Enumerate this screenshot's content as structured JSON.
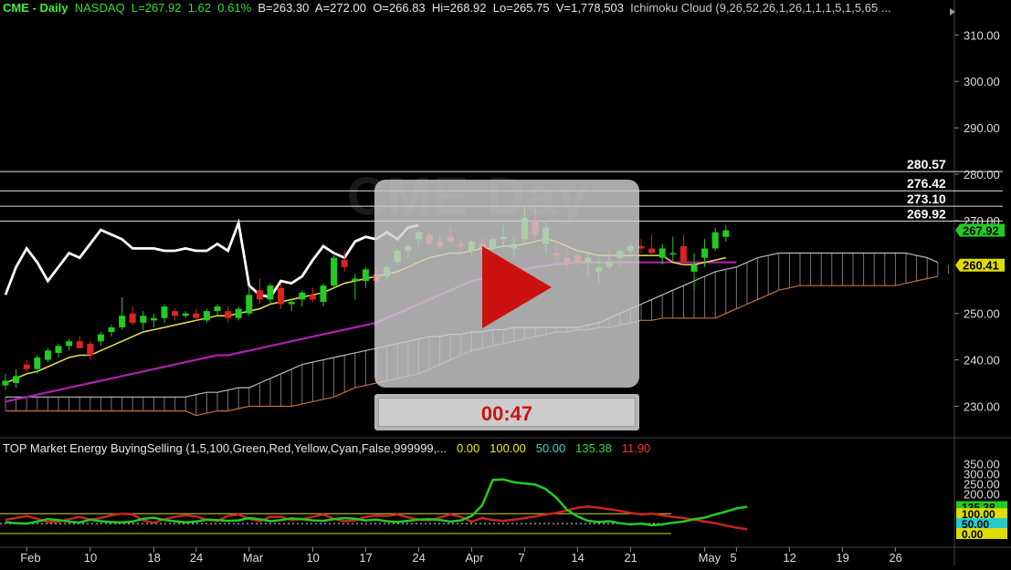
{
  "header": {
    "symbol": "CME - Daily",
    "exchange": "NASDAQ",
    "last": "L=267.92",
    "change": "1.62",
    "change_pct": "0.61%",
    "bid": "B=263.30",
    "ask": "A=272.00",
    "open": "O=266.83",
    "high": "Hi=268.92",
    "low": "Lo=265.75",
    "volume": "V=1,778,503",
    "study": "Ichimoku Cloud (9,26,52,26,1,26,1,1,1,5,1,5,65 ..."
  },
  "price_axis": [
    "310.00",
    "300.00",
    "290.00",
    "280.00",
    "270.00",
    "250.00",
    "240.00",
    "230.00"
  ],
  "levels": [
    {
      "label": "280.57",
      "value": 280.57
    },
    {
      "label": "276.42",
      "value": 276.42
    },
    {
      "label": "273.10",
      "value": 273.1
    },
    {
      "label": "269.92",
      "value": 269.92
    }
  ],
  "price_badges": [
    {
      "label": "267.92",
      "value": 267.92,
      "color": "#22cc22"
    },
    {
      "label": "260.41",
      "value": 260.41,
      "color": "#dddd00"
    }
  ],
  "indicator": {
    "title": "TOP Market Energy BuyingSelling (1,5,100,Green,Red,Yellow,Cyan,False,999999,...",
    "v1": "0.00",
    "v2": "100.00",
    "v3": "50.00",
    "v4": "135.38",
    "v5": "11.90",
    "axis": [
      "350.00",
      "300.00",
      "250.00",
      "200.00"
    ],
    "badges": [
      {
        "label": "135.38",
        "value": 135.38,
        "color": "#22cc22"
      },
      {
        "label": "100.00",
        "value": 100,
        "color": "#dddd00"
      },
      {
        "label": "50.00",
        "value": 50,
        "color": "#22cccc"
      },
      {
        "label": "0.00",
        "value": 0,
        "color": "#dddd00"
      }
    ]
  },
  "time_axis": [
    {
      "label": "Feb",
      "i": 2
    },
    {
      "label": "10",
      "i": 8
    },
    {
      "label": "18",
      "i": 14
    },
    {
      "label": "24",
      "i": 18
    },
    {
      "label": "Mar",
      "i": 23
    },
    {
      "label": "10",
      "i": 29
    },
    {
      "label": "17",
      "i": 34
    },
    {
      "label": "24",
      "i": 39
    },
    {
      "label": "Apr",
      "i": 44
    },
    {
      "label": "7",
      "i": 49
    },
    {
      "label": "14",
      "i": 54
    },
    {
      "label": "21",
      "i": 59
    },
    {
      "label": "May",
      "i": 66
    },
    {
      "label": "5",
      "i": 69
    },
    {
      "label": "12",
      "i": 74
    },
    {
      "label": "19",
      "i": 79
    },
    {
      "label": "26",
      "i": 84
    }
  ],
  "video": {
    "watermark": "CME Day",
    "timer": "00:47"
  },
  "colors": {
    "up": "#22cc22",
    "down": "#dd2222",
    "tenkan": "#e6e64a",
    "kijun": "#b020b0",
    "cloud": "#bbbbbb",
    "cloud_bear": "#c0703a",
    "chikou": "#ffffff",
    "buy": "#22cc22",
    "sell": "#cc2222"
  },
  "chart_data": {
    "type": "candlestick",
    "ylim": [
      224,
      314
    ],
    "candles": [
      [
        234.5,
        237,
        233.5,
        235.5
      ],
      [
        235,
        238,
        234,
        236.5
      ],
      [
        239,
        240,
        237.5,
        238
      ],
      [
        238,
        241,
        237,
        240.5
      ],
      [
        240,
        242.5,
        239.5,
        242
      ],
      [
        241.5,
        243.5,
        240.5,
        243
      ],
      [
        243,
        244.5,
        242,
        244
      ],
      [
        244,
        245,
        242.5,
        242.5
      ],
      [
        243.5,
        244,
        240,
        241
      ],
      [
        244,
        246,
        243,
        245.5
      ],
      [
        246,
        247.5,
        245,
        247
      ],
      [
        247,
        253.5,
        246.5,
        249.5
      ],
      [
        250,
        251.5,
        247.5,
        248
      ],
      [
        248,
        250.5,
        246.5,
        249.5
      ],
      [
        248.5,
        250,
        247,
        249
      ],
      [
        249,
        252,
        248,
        251.5
      ],
      [
        250.5,
        251,
        248.5,
        249.5
      ],
      [
        249.5,
        250.5,
        249,
        250
      ],
      [
        250,
        251,
        248.5,
        249
      ],
      [
        248.5,
        251,
        248,
        250.5
      ],
      [
        250.5,
        252,
        249.5,
        251.5
      ],
      [
        250.5,
        251.5,
        248,
        249
      ],
      [
        249,
        251.5,
        248.5,
        251
      ],
      [
        250,
        256,
        249.5,
        254
      ],
      [
        255,
        257.5,
        252,
        253
      ],
      [
        253,
        256.5,
        252,
        256
      ],
      [
        255.5,
        256.5,
        251,
        252
      ],
      [
        252,
        253,
        250.5,
        252.5
      ],
      [
        253,
        255,
        251.5,
        254.5
      ],
      [
        254,
        255.5,
        252.5,
        253
      ],
      [
        252.5,
        256.5,
        251.5,
        256
      ],
      [
        256,
        262.5,
        255.5,
        262
      ],
      [
        261.5,
        263.5,
        259,
        260
      ],
      [
        257,
        258.5,
        253,
        257.5
      ],
      [
        257,
        260,
        255.5,
        259.5
      ],
      [
        258.5,
        260,
        256.5,
        257
      ],
      [
        258,
        260.5,
        257.5,
        260
      ],
      [
        261,
        264,
        260.5,
        263.5
      ],
      [
        263.5,
        265,
        262,
        264.5
      ],
      [
        266,
        268,
        264.5,
        267.5
      ],
      [
        267,
        268,
        264.5,
        265
      ],
      [
        265.5,
        267,
        264,
        264.5
      ],
      [
        266.5,
        268.5,
        265,
        265.5
      ],
      [
        265,
        266,
        263.5,
        264.5
      ],
      [
        263.5,
        266,
        262.5,
        265.5
      ],
      [
        265,
        266.5,
        263,
        264
      ],
      [
        264,
        266.5,
        263.5,
        266
      ],
      [
        266,
        269,
        264.5,
        266.5
      ],
      [
        264,
        266.5,
        262,
        265
      ],
      [
        266,
        273,
        265,
        270.5
      ],
      [
        270,
        272.5,
        266,
        267
      ],
      [
        265,
        270,
        263,
        268.5
      ],
      [
        263,
        266,
        261,
        262.5
      ],
      [
        262,
        264,
        259.5,
        260.5
      ],
      [
        262.5,
        264,
        260,
        261
      ],
      [
        261,
        263,
        258,
        262
      ],
      [
        259,
        262,
        256.5,
        260
      ],
      [
        260,
        263.5,
        259.5,
        261
      ],
      [
        262,
        264,
        260,
        263.5
      ],
      [
        263.5,
        265,
        262.5,
        264.5
      ],
      [
        264.5,
        266,
        263,
        264
      ],
      [
        264,
        267,
        262.5,
        263
      ],
      [
        262,
        265,
        260.5,
        264
      ],
      [
        263,
        266.5,
        261,
        263
      ],
      [
        264.5,
        267,
        260.5,
        261
      ],
      [
        259,
        263,
        255,
        260.5
      ],
      [
        262,
        266,
        260,
        264
      ],
      [
        264,
        268.5,
        263.5,
        267.5
      ],
      [
        266.5,
        269,
        265.5,
        267.9
      ]
    ],
    "tenkan": [
      235,
      236,
      237,
      237.5,
      238.5,
      239.5,
      240.5,
      241,
      241,
      242,
      243,
      244,
      245,
      246,
      246.5,
      247,
      247.5,
      248,
      248.5,
      249,
      249.5,
      249.5,
      250,
      250.5,
      251,
      252,
      252.5,
      253,
      253.5,
      254,
      254.5,
      255.5,
      256.5,
      257,
      257.5,
      258,
      258.5,
      259,
      260,
      261,
      262,
      262.5,
      263,
      263,
      263.5,
      264,
      264,
      264.5,
      264.5,
      265,
      265.5,
      266,
      265.5,
      264.5,
      263.5,
      263,
      262.5,
      262.5,
      262.5,
      262.5,
      262.5,
      262.5,
      262.5,
      261,
      260.5,
      260.5,
      261,
      261.5,
      262
    ],
    "kijun": [
      231,
      231.5,
      232,
      232.5,
      233,
      233.5,
      234,
      234.5,
      235,
      235.5,
      236,
      236.5,
      237,
      237.5,
      238,
      238.5,
      239,
      239.5,
      240,
      240.5,
      241,
      241,
      241.5,
      242,
      242.5,
      243,
      243.5,
      244,
      244.5,
      245,
      245.5,
      246,
      246.5,
      247,
      247.5,
      248,
      249,
      250,
      251,
      252,
      253,
      254,
      255,
      256,
      257,
      257.5,
      258,
      258.5,
      259,
      259.5,
      260,
      260.3,
      260.6,
      260.8,
      261,
      261,
      261,
      261,
      261,
      261,
      261,
      261,
      261,
      261,
      261,
      261,
      261,
      261,
      261,
      261
    ],
    "chikou": [
      254,
      260,
      264,
      261,
      257,
      260,
      263,
      262,
      265,
      268,
      267,
      266,
      264,
      264,
      264,
      263.5,
      263.5,
      264,
      263.5,
      263.5,
      265,
      263.5,
      269.5,
      256,
      254,
      253.5,
      257,
      256.5,
      258,
      261.5,
      264.5,
      263,
      262,
      265.5,
      266.5,
      266,
      267.5,
      266,
      268.5,
      269
    ],
    "cloud_x0": 0,
    "span_a": [
      232,
      232,
      232,
      232,
      232,
      232,
      232,
      232,
      232,
      232,
      232,
      232,
      232,
      232,
      232,
      232,
      232,
      232,
      232.5,
      233,
      233,
      233.5,
      234,
      234,
      235,
      236,
      237,
      238,
      239,
      239.5,
      240,
      240.5,
      241,
      241.5,
      242,
      242.5,
      243,
      243.5,
      244,
      244.5,
      245,
      245,
      245.5,
      245.5,
      246,
      246,
      246.5,
      246.5,
      247,
      247,
      247,
      247,
      247,
      247,
      247,
      247.5,
      248,
      249,
      250,
      251,
      252,
      253,
      254,
      255,
      256,
      257,
      258,
      259,
      259.5,
      260,
      261,
      262,
      262.5,
      263,
      263,
      263,
      263,
      263,
      263,
      263,
      263,
      263,
      263,
      263,
      263,
      263,
      262.5,
      262,
      261,
      260.5,
      260.5,
      261,
      261,
      261,
      261,
      261,
      261,
      261,
      261,
      261,
      261
    ],
    "span_b": [
      229,
      229,
      229,
      229,
      229,
      229,
      229,
      229,
      229,
      229,
      229,
      229,
      229,
      229,
      229,
      229,
      229,
      229,
      228,
      228.5,
      229,
      229,
      229.5,
      230,
      230,
      230,
      230,
      230,
      230.5,
      231,
      231.5,
      232,
      233,
      234,
      234.5,
      235,
      235.5,
      236,
      236.5,
      237,
      238,
      239,
      240,
      241,
      242,
      242.5,
      243,
      243.5,
      244,
      244.5,
      245,
      245.5,
      246,
      246,
      246.5,
      246.5,
      247,
      247,
      247.5,
      248,
      248.5,
      248.5,
      249,
      249,
      249,
      249,
      249,
      249,
      250,
      251,
      252,
      253,
      254,
      255,
      255.5,
      256,
      256,
      256,
      256,
      256,
      256,
      256,
      256,
      256,
      256,
      256.5,
      257,
      257.5,
      258,
      258.5,
      258.5,
      258.5,
      258.5,
      258.5,
      258.5,
      258.5,
      258.5,
      258.5,
      258.5,
      258.5
    ],
    "buying": [
      58,
      52,
      50,
      60,
      72,
      68,
      60,
      55,
      70,
      62,
      58,
      56,
      60,
      74,
      80,
      68,
      62,
      56,
      60,
      70,
      68,
      64,
      66,
      78,
      72,
      62,
      68,
      76,
      72,
      66,
      64,
      72,
      78,
      74,
      66,
      70,
      62,
      58,
      64,
      70,
      72,
      68,
      60,
      66,
      88,
      142,
      270,
      272,
      258,
      252,
      246,
      224,
      180,
      120,
      86,
      64,
      58,
      62,
      52,
      46,
      50,
      42,
      46,
      54,
      60,
      72,
      80,
      96,
      110,
      126,
      135
    ],
    "selling": [
      70,
      78,
      88,
      74,
      58,
      60,
      72,
      84,
      70,
      78,
      92,
      100,
      96,
      66,
      54,
      72,
      84,
      92,
      86,
      70,
      64,
      88,
      96,
      74,
      62,
      84,
      84,
      68,
      72,
      84,
      96,
      74,
      62,
      66,
      84,
      90,
      88,
      96,
      82,
      70,
      66,
      80,
      96,
      84,
      60,
      78,
      68,
      64,
      70,
      78,
      86,
      96,
      104,
      116,
      130,
      136,
      130,
      122,
      114,
      104,
      96,
      100,
      92,
      84,
      78,
      70,
      60,
      52,
      40,
      30,
      22
    ],
    "ind_ylim": [
      -55,
      390
    ]
  }
}
